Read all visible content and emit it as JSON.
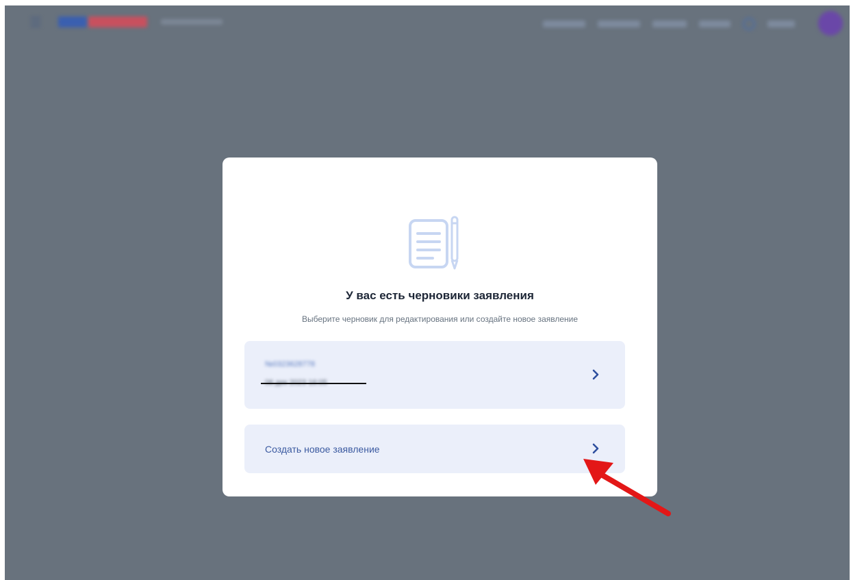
{
  "modal": {
    "title": "У вас есть черновики заявления",
    "subtitle": "Выберите черновик для редактирования или создайте новое заявление",
    "draft": {
      "number": "№0323628778",
      "date": "06 дек 2023 16:05"
    },
    "create_label": "Создать новое заявление"
  },
  "icons": {
    "document": "document-pencil-icon",
    "chevron": "chevron-right-icon",
    "annotation": "red-arrow-pointer"
  },
  "colors": {
    "overlay": "#68727d",
    "card_bg": "#ebeffa",
    "accent": "#3b5aa0",
    "annotation": "#e31717"
  }
}
